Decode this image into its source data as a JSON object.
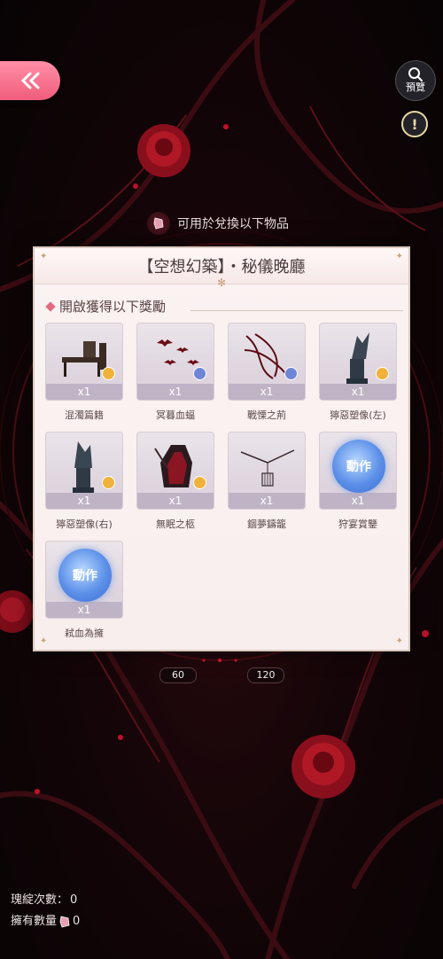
{
  "top": {
    "preview_label": "預覽"
  },
  "exchange_hint": "可用於兌換以下物品",
  "panel": {
    "title": "【空想幻築】・秘儀晚廳",
    "section_title": "開啟獲得以下獎勵"
  },
  "items": [
    {
      "name": "混濁篇籍",
      "qty": "x1",
      "badge": "gold",
      "icon": "desk-icon"
    },
    {
      "name": "冥暮血蝠",
      "qty": "x1",
      "badge": "blue",
      "icon": "bats-icon"
    },
    {
      "name": "戰慄之荊",
      "qty": "x1",
      "badge": "blue",
      "icon": "thorns-icon"
    },
    {
      "name": "獰惡塑像(左)",
      "qty": "x1",
      "badge": "gold",
      "icon": "gargoyle-icon"
    },
    {
      "name": "獰惡塑像(右)",
      "qty": "x1",
      "badge": "gold",
      "icon": "gargoyle-icon"
    },
    {
      "name": "無眠之柩",
      "qty": "x1",
      "badge": "gold",
      "icon": "coffin-icon"
    },
    {
      "name": "錮夢鑄籠",
      "qty": "x1",
      "badge": "none",
      "icon": "cage-icon"
    },
    {
      "name": "狩宴賞鑒",
      "qty": "x1",
      "badge": "none",
      "icon": "action-icon",
      "action_label": "動作"
    },
    {
      "name": "弒血為擁",
      "qty": "x1",
      "badge": "none",
      "icon": "action-icon",
      "action_label": "動作"
    }
  ],
  "milestones": [
    "60",
    "120"
  ],
  "stats": {
    "spin_count_label": "瑰綻次數：",
    "spin_count_value": "0",
    "owned_label": "擁有數量",
    "owned_value": "0"
  },
  "colors": {
    "accent_pink": "#f05d7c",
    "panel_bg": "#fbf3f2",
    "badge_gold": "#f0b23a",
    "badge_blue": "#6f86d6",
    "action_blue": "#5b8fe8"
  }
}
